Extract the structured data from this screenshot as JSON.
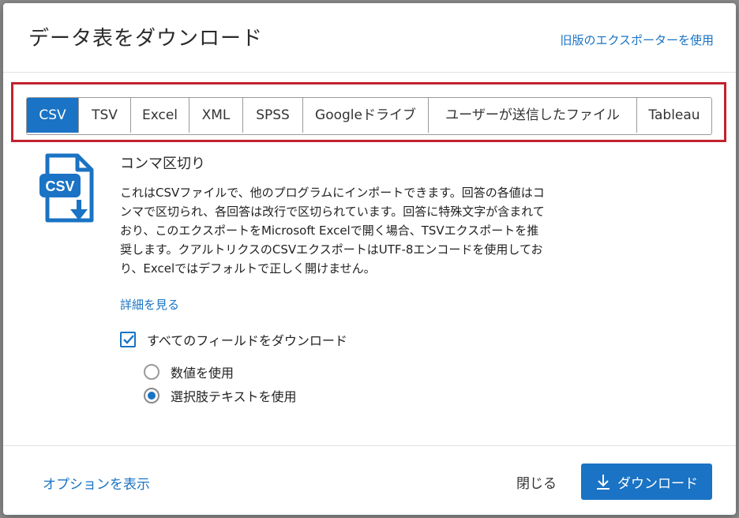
{
  "dialog": {
    "title": "データ表をダウンロード",
    "legacy_link": "旧版のエクスポーターを使用"
  },
  "tabs": [
    {
      "label": "CSV",
      "active": true
    },
    {
      "label": "TSV",
      "active": false
    },
    {
      "label": "Excel",
      "active": false
    },
    {
      "label": "XML",
      "active": false
    },
    {
      "label": "SPSS",
      "active": false
    },
    {
      "label": "Googleドライブ",
      "active": false
    },
    {
      "label": "ユーザーが送信したファイル",
      "active": false
    },
    {
      "label": "Tableau",
      "active": false
    }
  ],
  "format": {
    "icon_label": "CSV",
    "title": "コンマ区切り",
    "description": "これはCSVファイルで、他のプログラムにインポートできます。回答の各値はコンマで区切られ、各回答は改行で区切られています。回答に特殊文字が含まれており、このエクスポートをMicrosoft Excelで開く場合、TSVエクスポートを推奨します。クアルトリクスのCSVエクスポートはUTF-8エンコードを使用しており、Excelではデフォルトで正しく開けません。",
    "details_link": "詳細を見る"
  },
  "options": {
    "download_all_fields": {
      "label": "すべてのフィールドをダウンロード",
      "checked": true
    },
    "radios": [
      {
        "label": "数値を使用",
        "checked": false
      },
      {
        "label": "選択肢テキストを使用",
        "checked": true
      }
    ]
  },
  "footer": {
    "options_link": "オプションを表示",
    "close_label": "閉じる",
    "download_label": "ダウンロード"
  },
  "colors": {
    "accent": "#1a73c4",
    "highlight": "#c0232e"
  }
}
